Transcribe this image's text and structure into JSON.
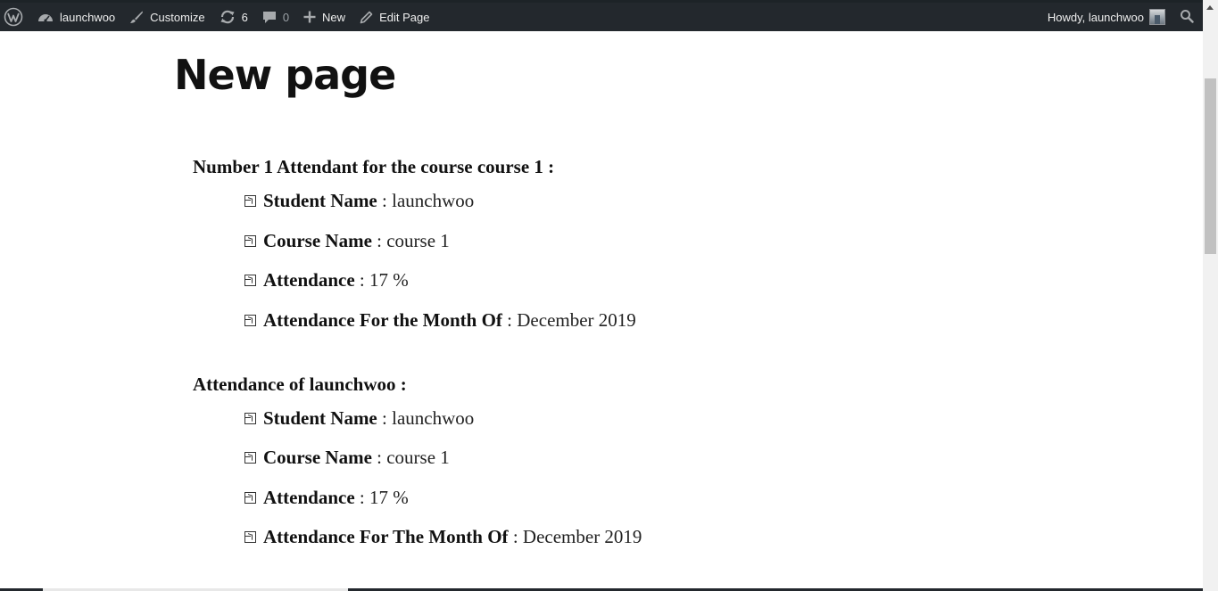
{
  "admin_bar": {
    "wp_logo_icon": "wordpress-logo-icon",
    "site_name": "launchwoo",
    "customize": "Customize",
    "updates_count": "6",
    "comments_count": "0",
    "new": "New",
    "edit_page": "Edit Page",
    "howdy": "Howdy, launchwoo",
    "background_color": "#23282d",
    "text_color": "#eeeeee"
  },
  "page": {
    "title": "New page",
    "blocks": [
      {
        "heading": "Number 1 Attendant for the course course 1 :",
        "items": [
          {
            "label": "Student Name",
            "value": "launchwoo"
          },
          {
            "label": "Course Name",
            "value": "course 1"
          },
          {
            "label": "Attendance",
            "value": "17 %"
          },
          {
            "label": "Attendance For the Month Of",
            "value": "December 2019"
          }
        ]
      },
      {
        "heading": "Attendance of launchwoo :",
        "items": [
          {
            "label": "Student Name",
            "value": "launchwoo"
          },
          {
            "label": "Course Name",
            "value": "course 1"
          },
          {
            "label": "Attendance",
            "value": "17 %"
          },
          {
            "label": "Attendance For The Month Of",
            "value": "December 2019"
          }
        ]
      }
    ]
  }
}
